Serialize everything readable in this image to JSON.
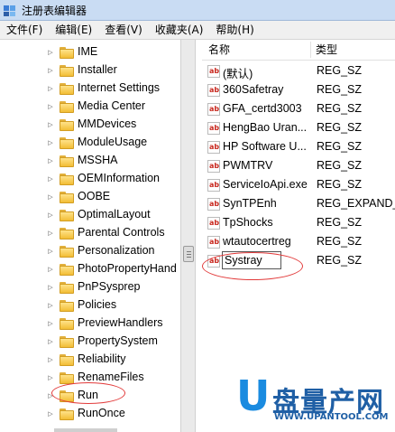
{
  "window": {
    "title": "注册表编辑器"
  },
  "menu": [
    "文件(F)",
    "编辑(E)",
    "查看(V)",
    "收藏夹(A)",
    "帮助(H)"
  ],
  "tree": {
    "items": [
      "IME",
      "Installer",
      "Internet Settings",
      "Media Center",
      "MMDevices",
      "ModuleUsage",
      "MSSHA",
      "OEMInformation",
      "OOBE",
      "OptimalLayout",
      "Parental Controls",
      "Personalization",
      "PhotoPropertyHand",
      "PnPSysprep",
      "Policies",
      "PreviewHandlers",
      "PropertySystem",
      "Reliability",
      "RenameFiles",
      "Run",
      "RunOnce"
    ]
  },
  "list": {
    "headers": {
      "name": "名称",
      "type": "类型"
    },
    "rows": [
      {
        "name": "(默认)",
        "type": "REG_SZ"
      },
      {
        "name": "360Safetray",
        "type": "REG_SZ"
      },
      {
        "name": "GFA_certd3003",
        "type": "REG_SZ"
      },
      {
        "name": "HengBao Uran...",
        "type": "REG_SZ"
      },
      {
        "name": "HP Software U...",
        "type": "REG_SZ"
      },
      {
        "name": "PWMTRV",
        "type": "REG_SZ"
      },
      {
        "name": "ServiceIoApi.exe",
        "type": "REG_SZ"
      },
      {
        "name": "SynTPEnh",
        "type": "REG_EXPAND_S"
      },
      {
        "name": "TpShocks",
        "type": "REG_SZ"
      },
      {
        "name": "wtautocertreg",
        "type": "REG_SZ"
      },
      {
        "name": "Systray",
        "type": "REG_SZ"
      }
    ],
    "icon": "ab"
  },
  "watermark": {
    "letter": "U",
    "brand": "盘量产网",
    "url": "WWW.UPANTOOL.COM"
  },
  "colors": {
    "highlight": "#e23a3a",
    "brand": "#1f5fa5"
  }
}
